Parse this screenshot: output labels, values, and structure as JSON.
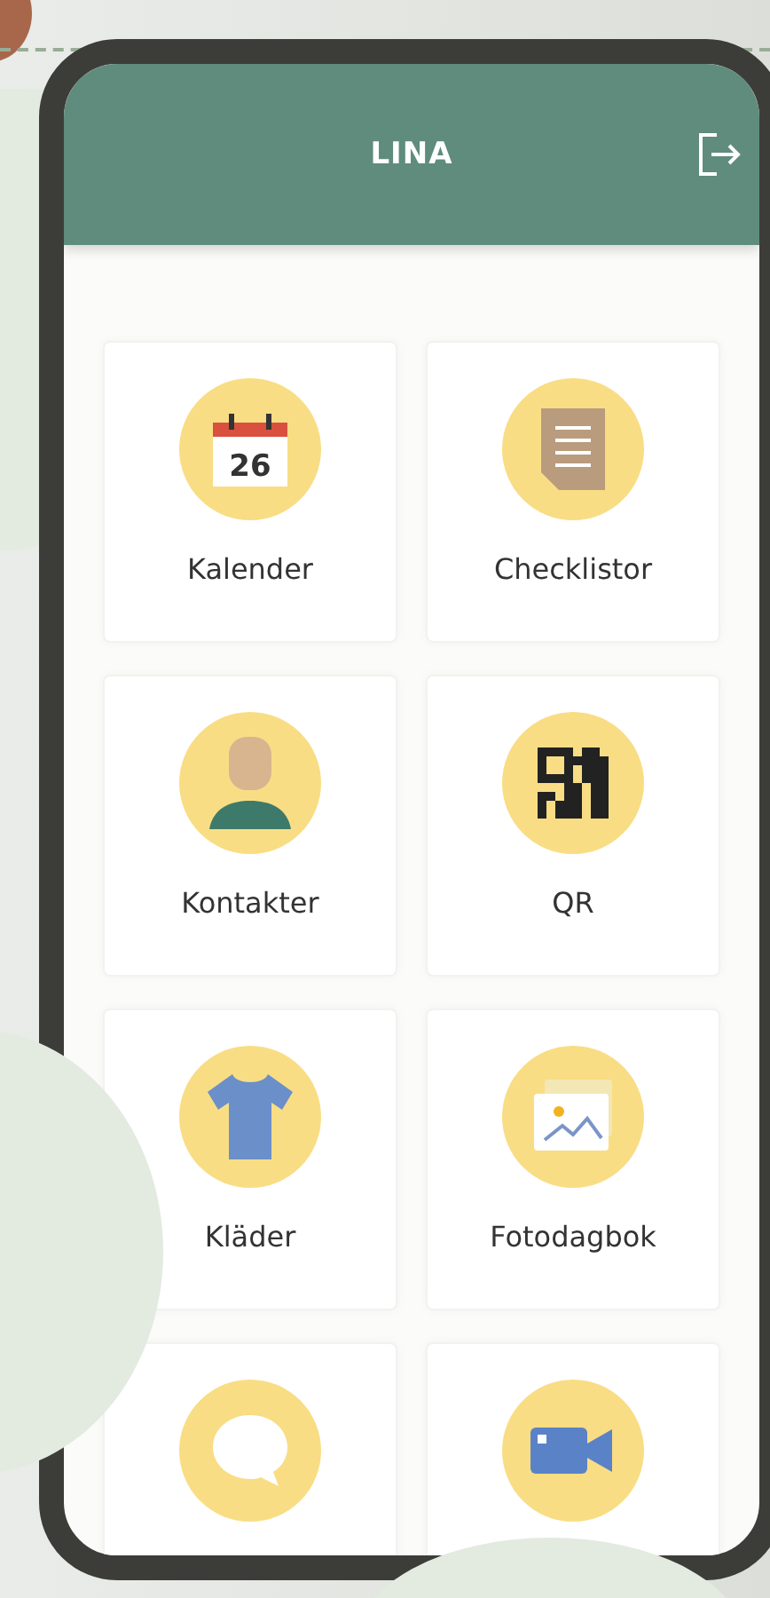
{
  "header": {
    "title": "LINA"
  },
  "tiles": [
    {
      "kind": "calendar",
      "date": "26",
      "label": "Kalender"
    },
    {
      "kind": "checklist",
      "label": "Checklistor"
    },
    {
      "kind": "contact",
      "label": "Kontakter"
    },
    {
      "kind": "qr",
      "label": "QR"
    },
    {
      "kind": "shirt",
      "label": "Kläder"
    },
    {
      "kind": "photo",
      "label": "Fotodagbok"
    },
    {
      "kind": "chat"
    },
    {
      "kind": "video"
    }
  ]
}
